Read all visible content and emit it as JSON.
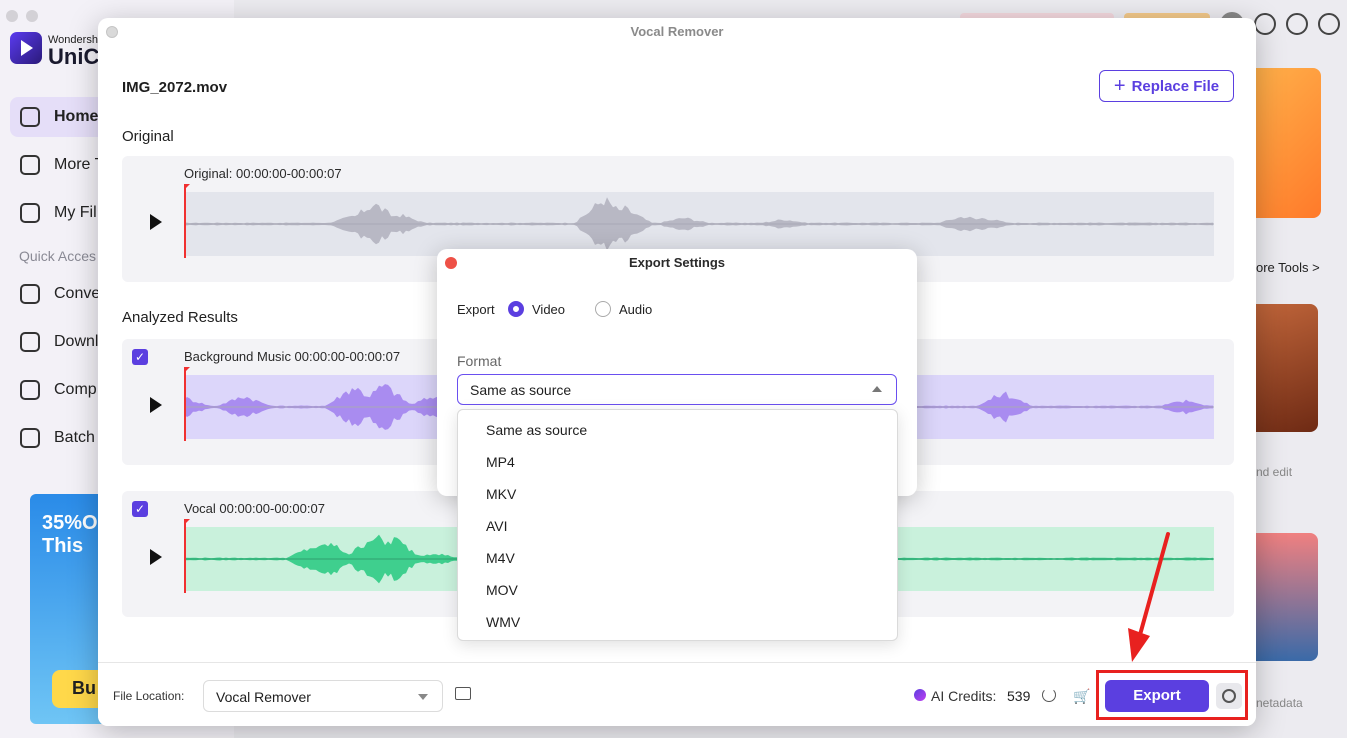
{
  "bg": {
    "brand_small": "Wondersh",
    "brand": "UniCo",
    "nav_top": [
      {
        "label": "Home",
        "active": true
      },
      {
        "label": "More T"
      },
      {
        "label": "My Fil"
      }
    ],
    "quick_access": "Quick Acces",
    "nav_bottom": [
      {
        "label": "Conve"
      },
      {
        "label": "Downl"
      },
      {
        "label": "Comp"
      },
      {
        "label": "Batch"
      }
    ],
    "promo_line1": "35%O",
    "promo_line2": "This",
    "promo_btn": "Bu",
    "more_tools": "ore Tools >",
    "card2_text": "nd edit",
    "card3_text": "netadata"
  },
  "dialog": {
    "title": "Vocal Remover",
    "filename": "IMG_2072.mov",
    "replace_label": "Replace File",
    "original_section": "Original",
    "results_section": "Analyzed Results",
    "tracks": [
      {
        "label": "Original: 00:00:00-00:00:07",
        "color": "#b8b8c4",
        "bg": "#e3e5ec"
      },
      {
        "label": "Background Music 00:00:00-00:00:07",
        "color": "#a98cf0",
        "bg": "#dcd6fa",
        "checked": true
      },
      {
        "label": "Vocal 00:00:00-00:00:07",
        "color": "#3fcf8e",
        "bg": "#c9f1dc",
        "checked": true
      }
    ]
  },
  "footer": {
    "location_label": "File Location:",
    "location_value": "Vocal Remover",
    "credits_label": "AI Credits:",
    "credits_value": "539",
    "export_label": "Export",
    "accent": "#5b3fe0"
  },
  "settings": {
    "title": "Export Settings",
    "export_label": "Export",
    "option_video": "Video",
    "option_audio": "Audio",
    "selected": "Video",
    "format_label": "Format",
    "format_value": "Same as source",
    "options": [
      "Same as source",
      "MP4",
      "MKV",
      "AVI",
      "M4V",
      "MOV",
      "WMV"
    ]
  }
}
